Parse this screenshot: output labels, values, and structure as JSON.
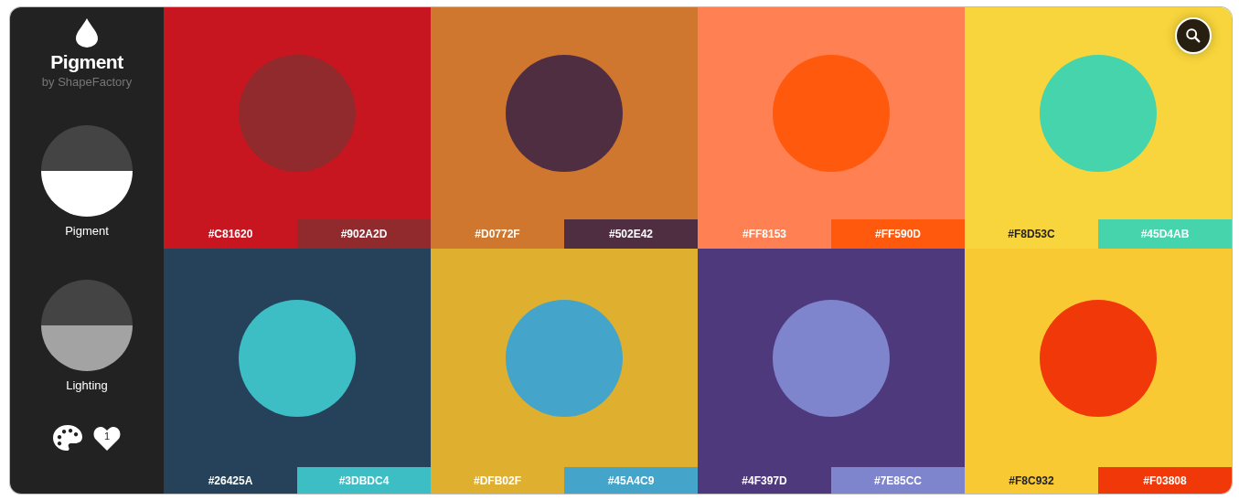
{
  "brand": {
    "title": "Pigment",
    "subtitle": "by ShapeFactory"
  },
  "modes": [
    {
      "label": "Pigment",
      "color": "#ffffff"
    },
    {
      "label": "Lighting",
      "color": "#a3a3a3"
    }
  ],
  "favorites": {
    "count": "1"
  },
  "palettes": [
    {
      "swatches": [
        {
          "hex": "#C81620",
          "color": "#c81620"
        },
        {
          "hex": "#902A2D",
          "color": "#902a2d"
        }
      ]
    },
    {
      "swatches": [
        {
          "hex": "#D0772F",
          "color": "#d0772f"
        },
        {
          "hex": "#502E42",
          "color": "#502e42"
        }
      ]
    },
    {
      "swatches": [
        {
          "hex": "#FF8153",
          "color": "#ff8153"
        },
        {
          "hex": "#FF590D",
          "color": "#ff590d"
        }
      ]
    },
    {
      "swatches": [
        {
          "hex": "#F8D53C",
          "color": "#f8d53c"
        },
        {
          "hex": "#45D4AB",
          "color": "#45d4ab"
        }
      ]
    },
    {
      "swatches": [
        {
          "hex": "#26425A",
          "color": "#26425a"
        },
        {
          "hex": "#3DBDC4",
          "color": "#3dbdc4"
        }
      ]
    },
    {
      "swatches": [
        {
          "hex": "#DFB02F",
          "color": "#dfb02f"
        },
        {
          "hex": "#45A4C9",
          "color": "#45a4c9"
        }
      ]
    },
    {
      "swatches": [
        {
          "hex": "#4F397D",
          "color": "#4f397d"
        },
        {
          "hex": "#7E85CC",
          "color": "#7e85cc"
        }
      ]
    },
    {
      "swatches": [
        {
          "hex": "#F8C932",
          "color": "#f8c932"
        },
        {
          "hex": "#F03808",
          "color": "#f03808"
        }
      ]
    }
  ]
}
